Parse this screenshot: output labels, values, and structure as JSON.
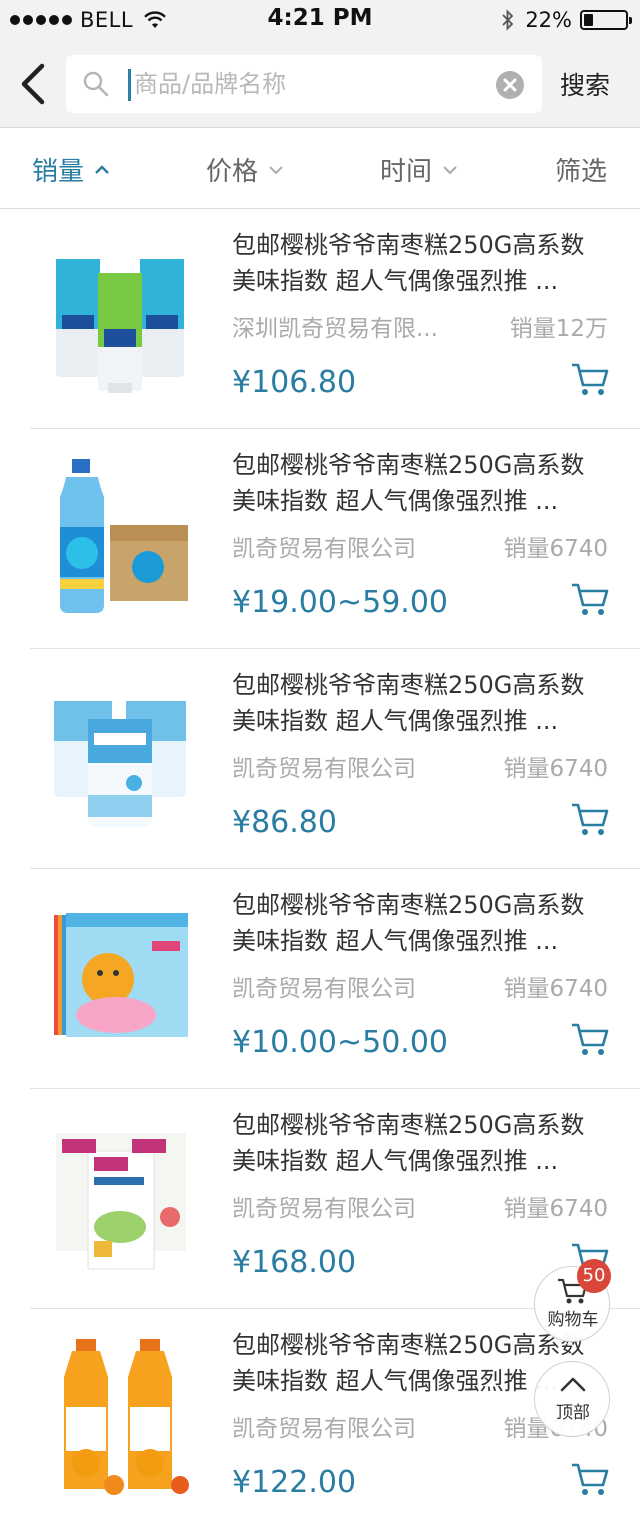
{
  "status_bar": {
    "carrier": "BELL",
    "time": "4:21 PM",
    "battery_pct": "22%",
    "battery_level": 0.22
  },
  "nav": {
    "search_placeholder": "商品/品牌名称",
    "search_button": "搜索"
  },
  "sort": {
    "sales": "销量",
    "price": "价格",
    "time": "时间",
    "filter": "筛选",
    "active": "sales"
  },
  "products": [
    {
      "title_line1": "包邮樱桃爷爷南枣糕250G高系数",
      "title_line2": "美味指数 超人气偶像强烈推 ...",
      "seller": "深圳凯奇贸易有限...",
      "sales": "销量12万",
      "price": "¥106.80",
      "image": "toothpaste-icon"
    },
    {
      "title_line1": "包邮樱桃爷爷南枣糕250G高系数",
      "title_line2": "美味指数 超人气偶像强烈推 ...",
      "seller": "凯奇贸易有限公司",
      "sales": "销量6740",
      "price": "¥19.00~59.00",
      "image": "water-bottle-icon"
    },
    {
      "title_line1": "包邮樱桃爷爷南枣糕250G高系数",
      "title_line2": "美味指数 超人气偶像强烈推 ...",
      "seller": "凯奇贸易有限公司",
      "sales": "销量6740",
      "price": "¥86.80",
      "image": "milk-powder-icon"
    },
    {
      "title_line1": "包邮樱桃爷爷南枣糕250G高系数",
      "title_line2": "美味指数 超人气偶像强烈推 ...",
      "seller": "凯奇贸易有限公司",
      "sales": "销量6740",
      "price": "¥10.00~50.00",
      "image": "book-icon"
    },
    {
      "title_line1": "包邮樱桃爷爷南枣糕250G高系数",
      "title_line2": "美味指数 超人气偶像强烈推 ...",
      "seller": "凯奇贸易有限公司",
      "sales": "销量6740",
      "price": "¥168.00",
      "image": "formula-box-icon"
    },
    {
      "title_line1": "包邮樱桃爷爷南枣糕250G高系数",
      "title_line2": "美味指数 超人气偶像强烈推 ...",
      "seller": "凯奇贸易有限公司",
      "sales": "销量6740",
      "price": "¥122.00",
      "image": "juice-bottle-icon"
    }
  ],
  "float": {
    "cart_label": "购物车",
    "cart_count": "50",
    "top_label": "顶部"
  },
  "colors": {
    "accent": "#2a7da2",
    "badge": "#d9463a"
  }
}
